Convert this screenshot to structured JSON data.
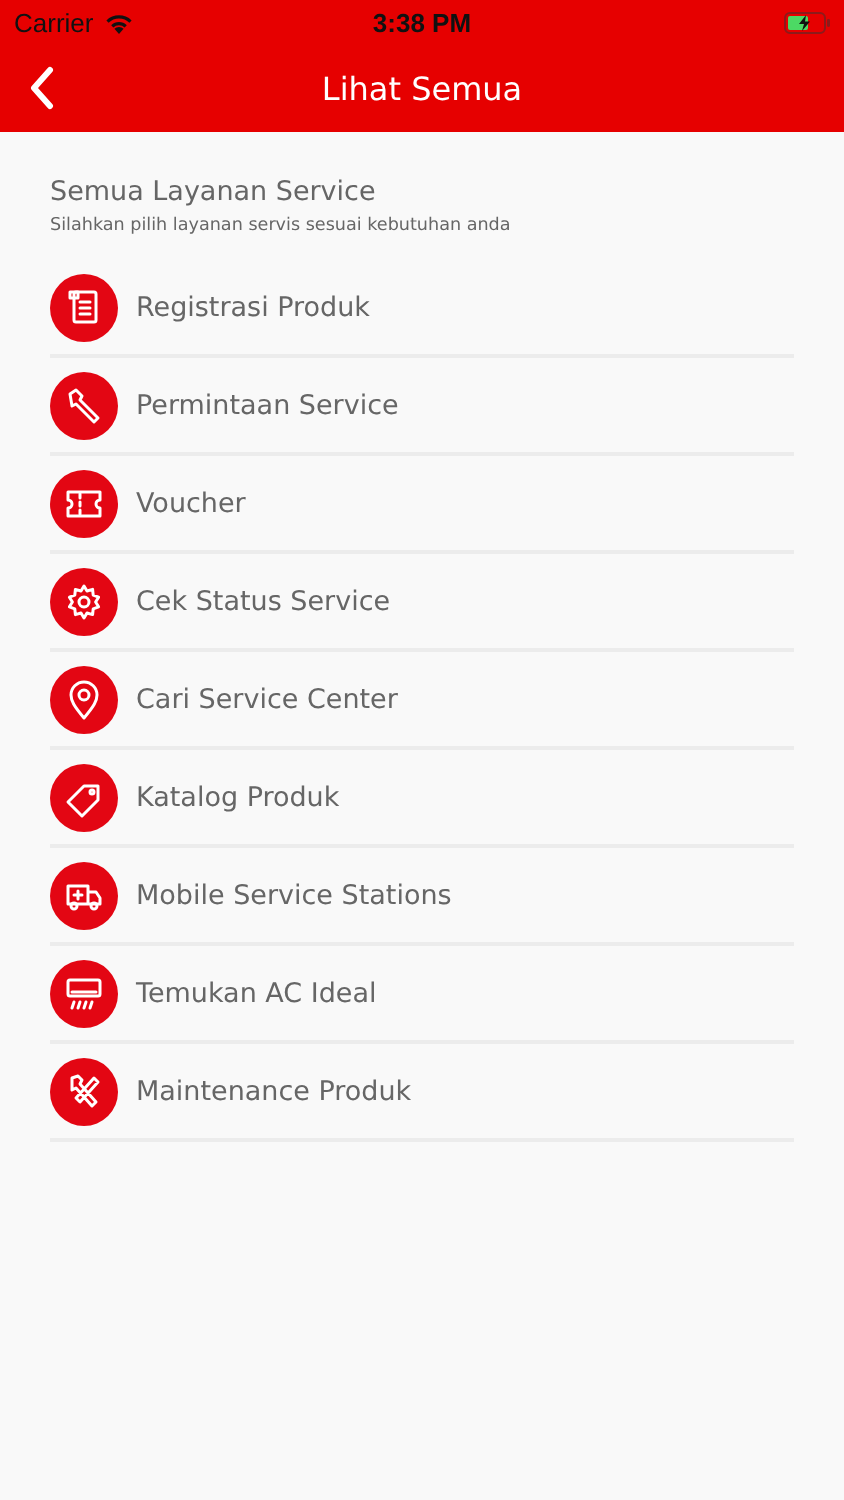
{
  "status_bar": {
    "carrier": "Carrier",
    "time": "3:38 PM"
  },
  "header": {
    "title": "Lihat Semua"
  },
  "section": {
    "title": "Semua Layanan Service",
    "subtitle": "Silahkan pilih layanan servis sesuai kebutuhan anda"
  },
  "items": [
    {
      "kind": "document",
      "label": "Registrasi Produk"
    },
    {
      "kind": "wrench",
      "label": "Permintaan Service"
    },
    {
      "kind": "ticket",
      "label": "Voucher"
    },
    {
      "kind": "gear",
      "label": "Cek Status Service"
    },
    {
      "kind": "pin",
      "label": "Cari Service Center"
    },
    {
      "kind": "tag",
      "label": "Katalog Produk"
    },
    {
      "kind": "truck",
      "label": "Mobile Service Stations"
    },
    {
      "kind": "aircon",
      "label": "Temukan AC Ideal"
    },
    {
      "kind": "tools",
      "label": "Maintenance Produk"
    }
  ]
}
